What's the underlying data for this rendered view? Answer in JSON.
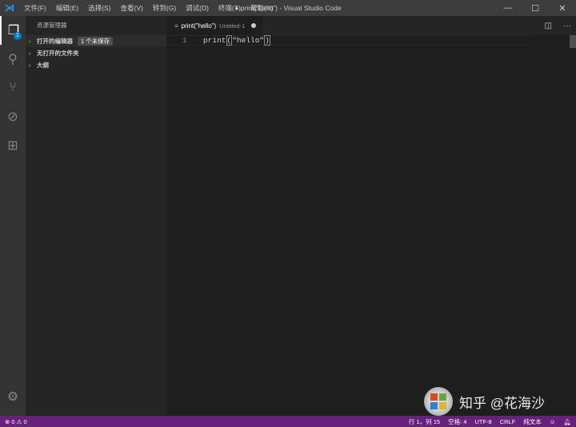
{
  "titlebar": {
    "menu": [
      "文件(F)",
      "编辑(E)",
      "选择(S)",
      "查看(V)",
      "转到(G)",
      "调试(D)",
      "终端(T)",
      "帮助(H)"
    ],
    "title": "● print(\"hello\") - Visual Studio Code"
  },
  "activity": {
    "badge": "1"
  },
  "sidebar": {
    "title": "资源管理器",
    "sections": [
      {
        "label": "打开的编辑器",
        "badge": "1 个未保存"
      },
      {
        "label": "无打开的文件夹"
      },
      {
        "label": "大纲"
      }
    ]
  },
  "editor": {
    "tab": {
      "title": "print(\"hello\")",
      "desc": "Untitled-1"
    },
    "line_number": "1",
    "code_pre": "print",
    "code_paren_open": "(",
    "code_str": "\"hello\"",
    "code_paren_close": ")"
  },
  "status": {
    "errors": "0",
    "warnings": "0",
    "position": "行 1，列 15",
    "spaces": "空格: 4",
    "encoding": "UTF-8",
    "eol": "CRLF",
    "language": "纯文本"
  },
  "watermark": {
    "text": "知乎 @花海沙"
  },
  "colors": {
    "status": "#68217a",
    "accent": "#007acc"
  }
}
